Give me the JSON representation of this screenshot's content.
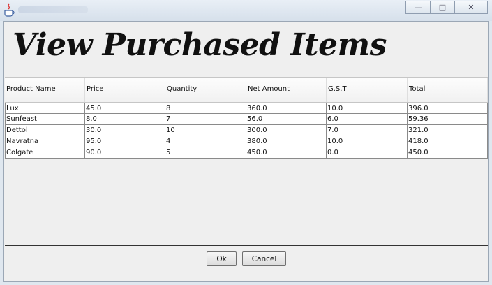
{
  "window": {
    "icons": {
      "app": "java-coffee-icon",
      "minimize": "minimize-icon",
      "maximize": "maximize-icon",
      "close": "close-icon"
    }
  },
  "heading": "View Purchased Items",
  "table": {
    "columns": [
      "Product Name",
      "Price",
      "Quantity",
      "Net Amount",
      "G.S.T",
      "Total"
    ],
    "rows": [
      [
        "Lux",
        "45.0",
        "8",
        "360.0",
        "10.0",
        "396.0"
      ],
      [
        "Sunfeast",
        "8.0",
        "7",
        "56.0",
        "6.0",
        "59.36"
      ],
      [
        "Dettol",
        "30.0",
        "10",
        "300.0",
        "7.0",
        "321.0"
      ],
      [
        "Navratna",
        "95.0",
        "4",
        "380.0",
        "10.0",
        "418.0"
      ],
      [
        "Colgate",
        "90.0",
        "5",
        "450.0",
        "0.0",
        "450.0"
      ]
    ]
  },
  "buttons": {
    "ok": "Ok",
    "cancel": "Cancel"
  }
}
